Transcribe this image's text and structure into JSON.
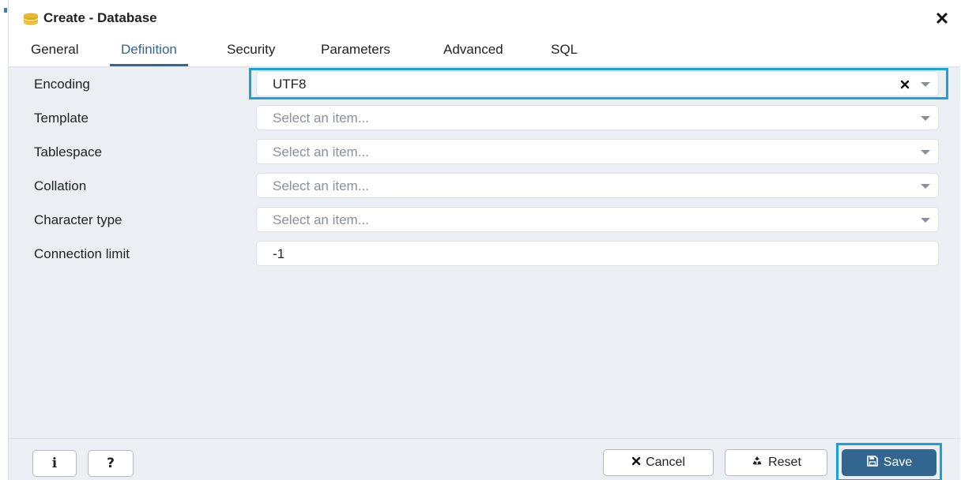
{
  "dialog": {
    "title": "Create - Database",
    "title_icon": "database-icon",
    "close_icon": "close-icon"
  },
  "tabs": [
    {
      "label": "General",
      "active": false
    },
    {
      "label": "Definition",
      "active": true
    },
    {
      "label": "Security",
      "active": false
    },
    {
      "label": "Parameters",
      "active": false
    },
    {
      "label": "Advanced",
      "active": false
    },
    {
      "label": "SQL",
      "active": false
    }
  ],
  "form": {
    "encoding": {
      "label": "Encoding",
      "value": "UTF8"
    },
    "template": {
      "label": "Template",
      "placeholder": "Select an item..."
    },
    "tablespace": {
      "label": "Tablespace",
      "placeholder": "Select an item..."
    },
    "collation": {
      "label": "Collation",
      "placeholder": "Select an item..."
    },
    "character_type": {
      "label": "Character type",
      "placeholder": "Select an item..."
    },
    "connection_limit": {
      "label": "Connection limit",
      "value": "-1"
    }
  },
  "footer": {
    "info_label": "i",
    "help_label": "?",
    "cancel_label": "Cancel",
    "reset_label": "Reset",
    "save_label": "Save"
  },
  "colors": {
    "accent": "#326690",
    "highlight": "#1aa0dc",
    "panel_bg": "#ebeef3",
    "db_icon": "#e8b92c"
  }
}
